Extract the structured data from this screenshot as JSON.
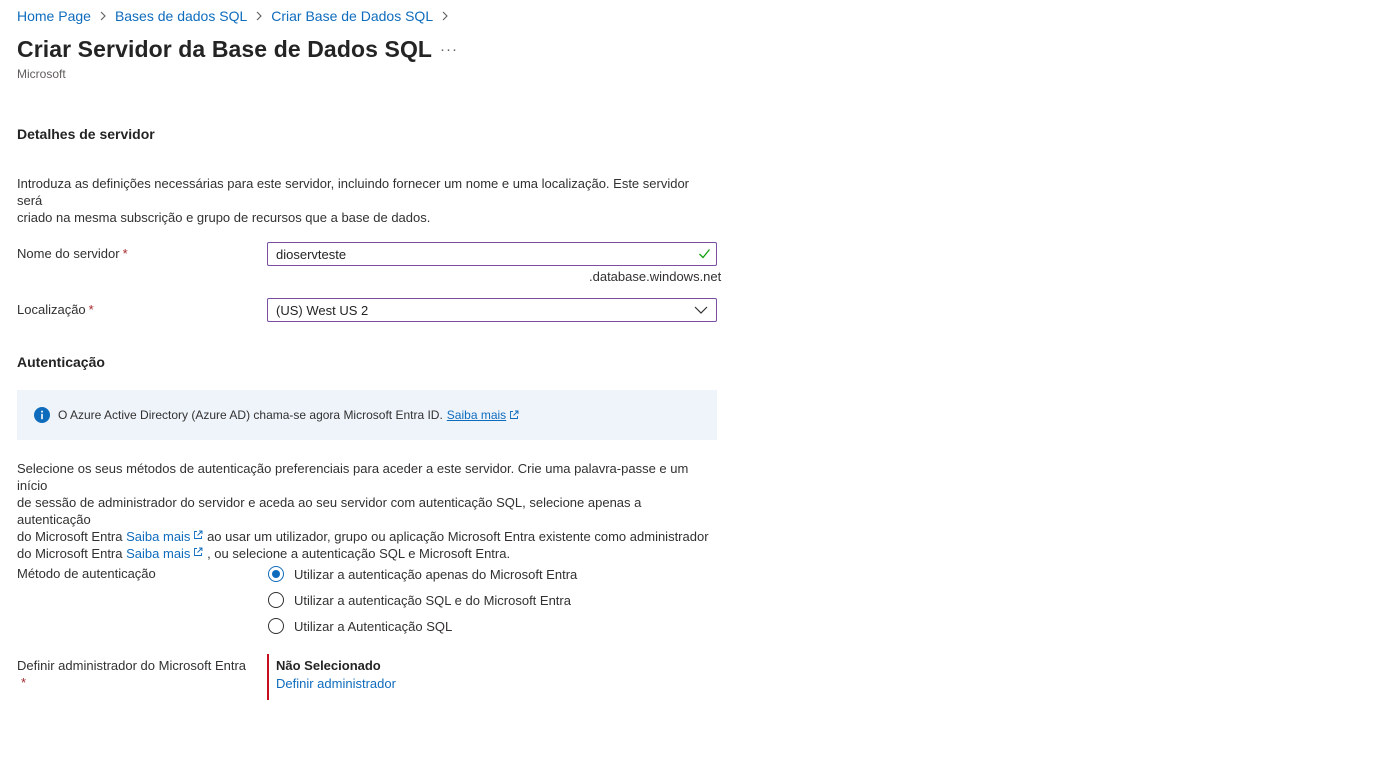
{
  "breadcrumb": {
    "items": [
      "Home Page",
      "Bases de dados SQL",
      "Criar Base de Dados SQL"
    ]
  },
  "header": {
    "title": "Criar Servidor da Base de Dados SQL",
    "more_label": "···",
    "publisher": "Microsoft"
  },
  "server_details": {
    "heading": "Detalhes de servidor",
    "description_line1": "Introduza as definições necessárias para este servidor, incluindo fornecer um nome e uma localização. Este servidor será",
    "description_line2": "criado na mesma subscrição e grupo de recursos que a base de dados.",
    "server_name": {
      "label": "Nome do servidor",
      "required_mark": "*",
      "value": "dioservteste",
      "suffix": ".database.windows.net"
    },
    "location": {
      "label": "Localização",
      "required_mark": "*",
      "value": "(US) West US 2"
    }
  },
  "authentication": {
    "heading": "Autenticação",
    "info_banner": {
      "text": "O Azure Active Directory (Azure AD) chama-se agora Microsoft Entra ID.",
      "link": "Saiba mais"
    },
    "description": {
      "line1": "Selecione os seus métodos de autenticação preferenciais para aceder a este servidor. Crie uma palavra-passe e um início",
      "line2": "de sessão de administrador do servidor e aceda ao seu servidor com autenticação SQL, selecione apenas a autenticação",
      "line3_pre": "do Microsoft Entra",
      "line3_link": "Saiba mais",
      "line3_post": "ao usar um utilizador, grupo ou aplicação Microsoft Entra existente como administrador",
      "line4_pre": "do Microsoft Entra",
      "line4_link": "Saiba mais",
      "line4_post": ", ou selecione a autenticação SQL e Microsoft Entra."
    },
    "method": {
      "label": "Método de autenticação",
      "options": [
        {
          "label": "Utilizar a autenticação apenas do Microsoft Entra",
          "selected": true
        },
        {
          "label": "Utilizar a autenticação SQL e do Microsoft Entra",
          "selected": false
        },
        {
          "label": "Utilizar a Autenticação SQL",
          "selected": false
        }
      ]
    },
    "admin": {
      "label": "Definir administrador do Microsoft Entra",
      "required_mark": "*",
      "status": "Não Selecionado",
      "link": "Definir administrador"
    }
  },
  "colors": {
    "link": "#0f6cbd",
    "input_border": "#7a4d9e",
    "required": "#a4262c",
    "error_bar": "#c50f1f",
    "info_bg": "#eff4fb",
    "valid_check": "#13a10e"
  }
}
